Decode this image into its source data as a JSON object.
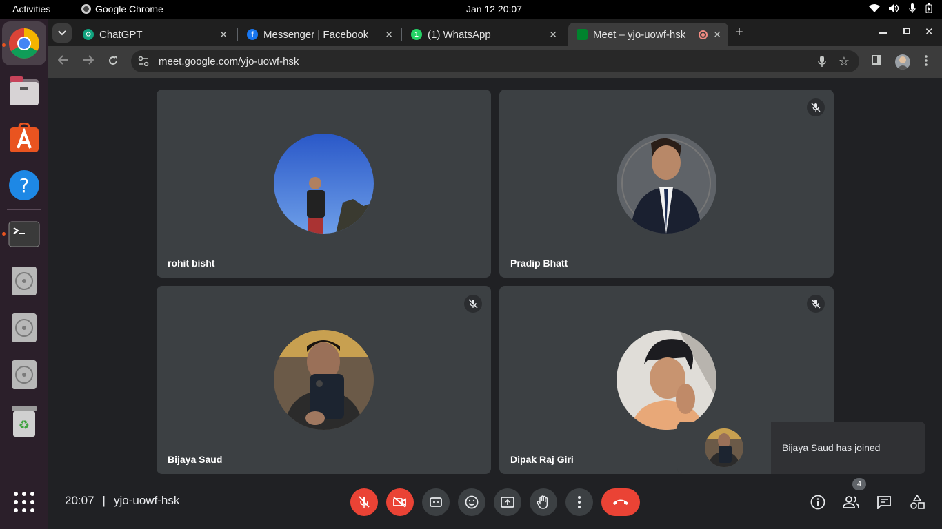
{
  "system": {
    "activities": "Activities",
    "app_name": "Google Chrome",
    "clock": "Jan 12  20:07"
  },
  "tabs": [
    {
      "title": "ChatGPT",
      "icon": "chatgpt-icon",
      "color": "#10a37f"
    },
    {
      "title": "Messenger | Facebook",
      "icon": "facebook-icon",
      "color": "#1877f2"
    },
    {
      "title": "(1) WhatsApp",
      "icon": "whatsapp-icon",
      "color": "#25d366"
    },
    {
      "title": "Meet – yjo-uowf-hsk",
      "icon": "google-meet-icon",
      "color": "#00832d"
    }
  ],
  "address": {
    "url": "meet.google.com/yjo-uowf-hsk"
  },
  "participants": [
    {
      "name": "rohit bisht",
      "muted": false
    },
    {
      "name": "Pradip Bhatt",
      "muted": true
    },
    {
      "name": "Bijaya Saud",
      "muted": true
    },
    {
      "name": "Dipak Raj Giri",
      "muted": true
    }
  ],
  "toast": {
    "message": "Bijaya Saud has joined"
  },
  "meeting": {
    "time": "20:07",
    "separator": "|",
    "code": "yjo-uowf-hsk",
    "people_count": "4"
  },
  "colors": {
    "accent_red": "#ea4335",
    "tile_bg": "#3c4043",
    "page_bg": "#202124",
    "dock_bg": "#2b1f2a"
  }
}
